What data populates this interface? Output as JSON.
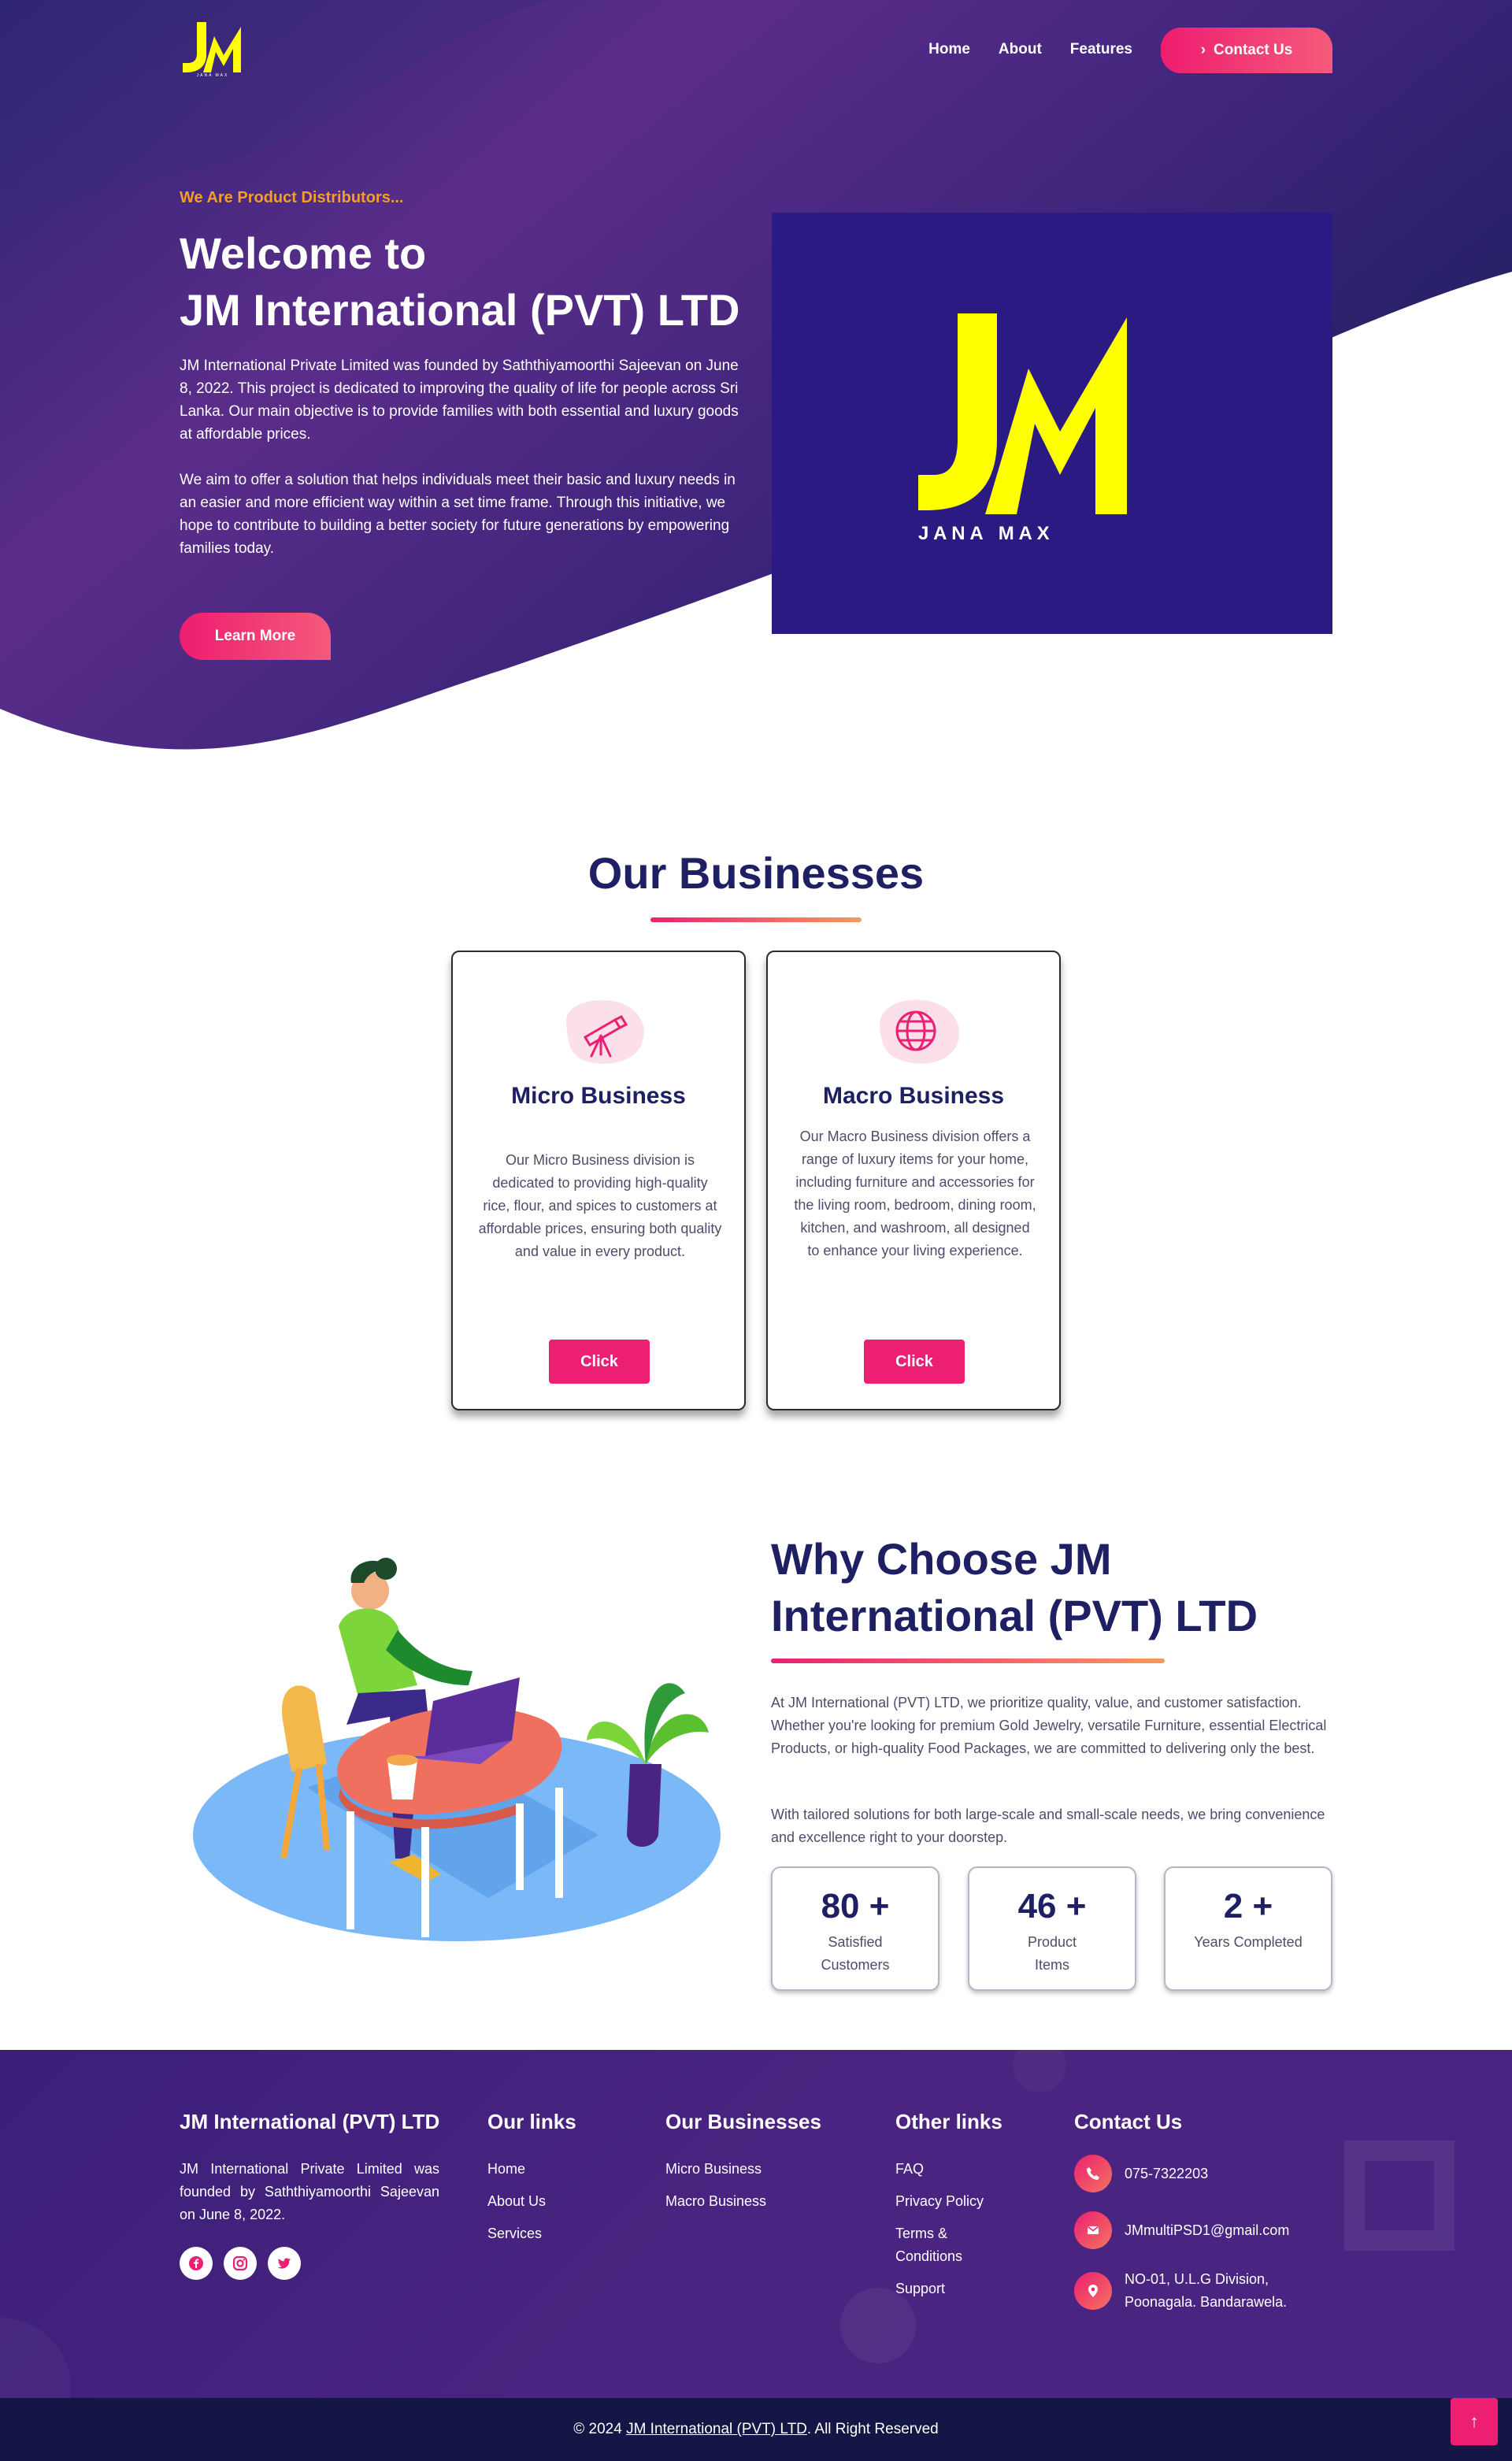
{
  "nav": {
    "logo_letters": "JM",
    "logo_sub": "JANA MAX",
    "links": [
      "Home",
      "About",
      "Features"
    ],
    "cta_label": "Contact Us"
  },
  "hero": {
    "kicker": "We Are Product Distributors...",
    "title_line1": "Welcome to",
    "title_line2": "JM International (PVT) LTD",
    "para1": "JM International Private Limited was founded by Saththiyamoorthi Sajeevan on June 8, 2022. This project is dedicated to improving the quality of life for people across Sri Lanka. Our main objective is to provide families with both essential and luxury goods at affordable prices.",
    "para2": "We aim to offer a solution that helps individuals meet their basic and luxury needs in an easier and more efficient way within a set time frame. Through this initiative, we hope to contribute to building a better society for future generations by empowering families today.",
    "button_label": "Learn More",
    "panel_logo_letters": "JM",
    "panel_logo_sub": "J A N A   M A X",
    "colors": {
      "accent": "#ec1f72",
      "kicker": "#f59d2a",
      "panel": "#2a1a82",
      "logo_yellow": "#ffff00"
    }
  },
  "businesses": {
    "title": "Our Businesses",
    "cards": [
      {
        "icon": "telescope-icon",
        "title": "Micro Business",
        "text": "Our Micro Business division is dedicated to providing high-quality rice, flour, and spices to customers at affordable prices, ensuring both quality and value in every product.",
        "button_label": "Click"
      },
      {
        "icon": "globe-icon",
        "title": "Macro Business",
        "text": "Our Macro Business division offers a range of luxury items for your home, including furniture and accessories for the living room, bedroom, dining room, kitchen, and washroom, all designed to enhance your living experience.",
        "button_label": "Click"
      }
    ]
  },
  "why": {
    "title_line1": "Why Choose JM",
    "title_line2": "International (PVT) LTD",
    "para1": "At JM International (PVT) LTD, we prioritize quality, value, and customer satisfaction. Whether you're looking for premium Gold Jewelry, versatile Furniture, essential Electrical Products, or high-quality Food Packages, we are committed to delivering only the best.",
    "para2": "With tailored solutions for both large-scale and small-scale needs, we bring convenience and excellence right to your doorstep.",
    "stats": [
      {
        "value": "80 +",
        "label": "Satisfied Customers"
      },
      {
        "value": "46 +",
        "label": "Product Items"
      },
      {
        "value": "2 +",
        "label": "Years Completed"
      }
    ]
  },
  "footer": {
    "company_title": "JM International (PVT) LTD",
    "company_text": "JM International Private Limited was founded by Saththiyamoorthi Sajeevan on June 8, 2022.",
    "socials": [
      "facebook-icon",
      "instagram-icon",
      "twitter-icon"
    ],
    "links_title": "Our links",
    "links": [
      "Home",
      "About Us",
      "Services"
    ],
    "businesses_title": "Our Businesses",
    "businesses": [
      "Micro Business",
      "Macro Business"
    ],
    "other_title": "Other links",
    "other": [
      "FAQ",
      "Privacy Policy",
      "Terms & Conditions",
      "Support"
    ],
    "contact_title": "Contact Us",
    "phone": "075-7322203",
    "email": "JMmultiPSD1@gmail.com",
    "address_line1": "NO-01, U.L.G Division,",
    "address_line2": "Poonagala. Bandarawela."
  },
  "bottom": {
    "copyright_prefix": "© 2024 ",
    "copyright_link": "JM International (PVT) LTD",
    "copyright_suffix": ". All Right Reserved"
  }
}
